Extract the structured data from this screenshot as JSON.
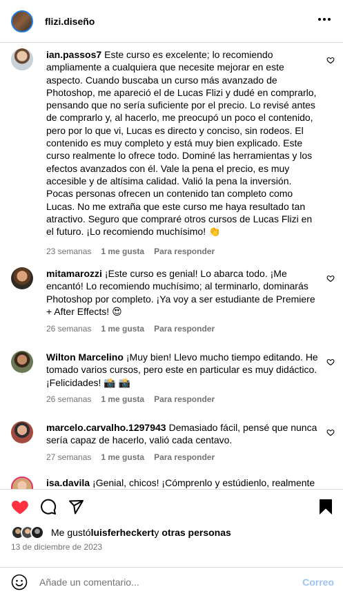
{
  "header": {
    "username": "flizi.diseño"
  },
  "comments": [
    {
      "username": "ian.passos7",
      "text": "Este curso es excelente; lo recomiendo ampliamente a cualquiera que necesite mejorar en este aspecto. Cuando buscaba un curso más avanzado de Photoshop, me apareció el de Lucas Flizi y dudé en comprarlo, pensando que no sería suficiente por el precio. Lo revisé antes de comprarlo y, al hacerlo, me preocupó un poco el contenido, pero por lo que vi, Lucas es directo y conciso, sin rodeos. El contenido es muy completo y está muy bien explicado. Este curso realmente lo ofrece todo. Dominé las herramientas y los efectos avanzados con él. Vale la pena el precio, es muy accesible y de altísima calidad. Valió la pena la inversión. Pocas personas ofrecen un contenido tan completo como Lucas. No me extraña que este curso me haya resultado tan atractivo. Seguro que compraré otros cursos de Lucas Flizi en el futuro. ¡Lo recomiendo muchísimo! 👏",
      "time": "23 semanas",
      "likes": "1 me gusta",
      "reply": "Para responder"
    },
    {
      "username": "mitamarozzi",
      "text": "¡Este curso es genial! Lo abarca todo. ¡Me encantó! Lo recomiendo muchísimo; al terminarlo, dominarás Photoshop por completo. ¡Ya voy a ser estudiante de Premiere + After Effects! 😍",
      "time": "26 semanas",
      "likes": "1 me gusta",
      "reply": "Para responder"
    },
    {
      "username": "Wilton Marcelino",
      "text": "¡Muy bien! Llevo mucho tiempo editando. He tomado varios cursos, pero este en particular es muy didáctico. ¡Felicidades! 📸 📸",
      "time": "26 semanas",
      "likes": "1 me gusta",
      "reply": "Para responder"
    },
    {
      "username": "marcelo.carvalho.1297943",
      "text": "Demasiado fácil, pensé que nunca sería capaz de hacerlo, valió cada centavo.",
      "time": "27 semanas",
      "likes": "1 me gusta",
      "reply": "Para responder"
    },
    {
      "username": "isa.davila",
      "text": "¡Genial, chicos! ¡Cómprenlo y estúdienlo, realmente",
      "time": "",
      "likes": "",
      "reply": ""
    }
  ],
  "likes": {
    "prefix": "Me gustó",
    "user": "luisferheckert",
    "suffix": "y",
    "others": "otras personas"
  },
  "date": "13 de diciembre de 2023",
  "comment_box": {
    "placeholder": "Añade un comentario...",
    "post_label": "Correo"
  },
  "colors": {
    "like_red": "#ff3040",
    "meta_gray": "#737373",
    "post_blue_disabled": "#9bc4f5",
    "divider": "#dbdbdb"
  },
  "icons": {
    "header": "more-horizontal-icon",
    "actions": [
      "heart-filled-icon",
      "comment-icon",
      "share-icon",
      "bookmark-icon"
    ],
    "comment": "heart-outline-icon",
    "composer": "emoji-icon"
  }
}
